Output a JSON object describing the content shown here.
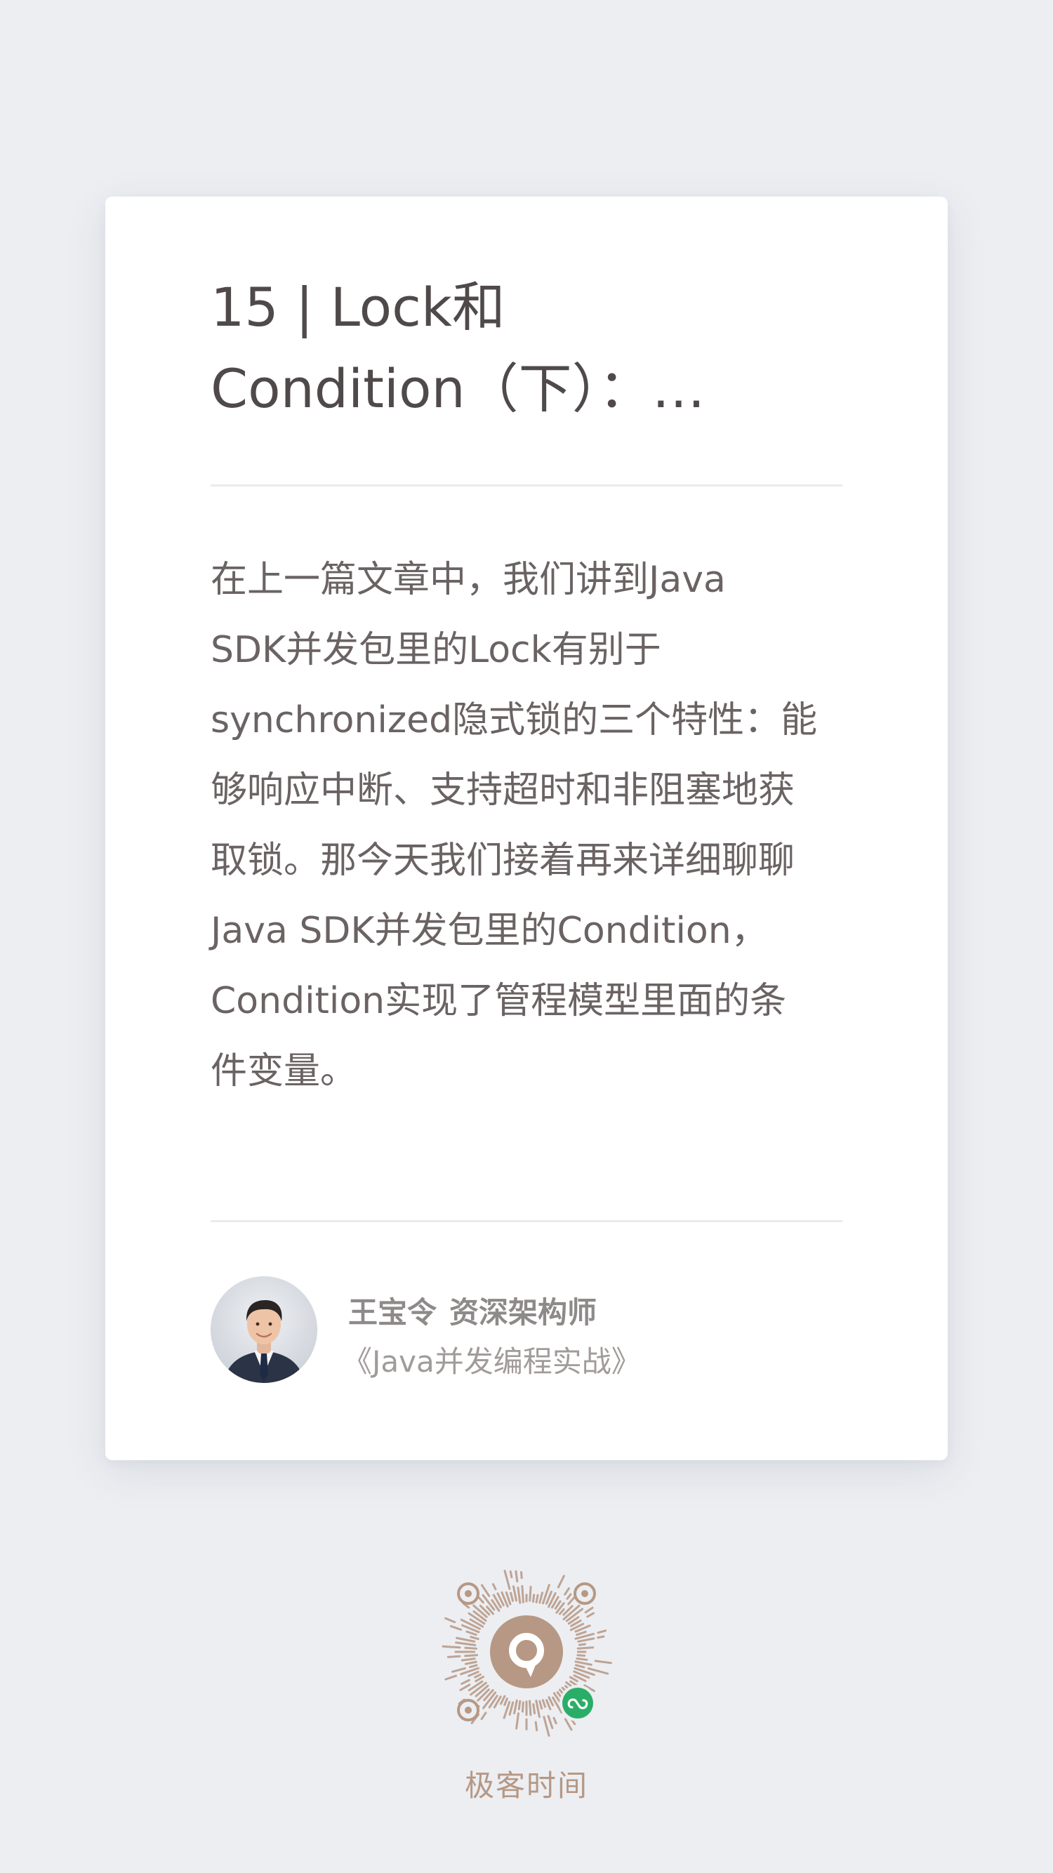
{
  "article": {
    "title_lines": [
      "15 | Lock和",
      "Condition（下）：…"
    ],
    "summary_lines": [
      "在上一篇文章中，我们讲到Java",
      "SDK并发包里的Lock有别于",
      "synchronized隐式锁的三个特性：能",
      "够响应中断、支持超时和非阻塞地获",
      "取锁。那今天我们接着再来详细聊聊",
      "Java SDK并发包里的Condition，",
      "Condition实现了管程模型里面的条",
      "件变量。"
    ]
  },
  "author": {
    "name": "王宝令",
    "role": "资深架构师",
    "course": "《Java并发编程实战》",
    "avatar_icon": "author-avatar-photo"
  },
  "footer": {
    "qr_icon": "mini-program-code-icon",
    "brand": "极客时间"
  },
  "colors": {
    "background": "#eceef2",
    "card": "#ffffff",
    "title": "#50494a",
    "body": "#6b6363",
    "brand": "#b69884",
    "wechat_badge": "#2aae67"
  }
}
